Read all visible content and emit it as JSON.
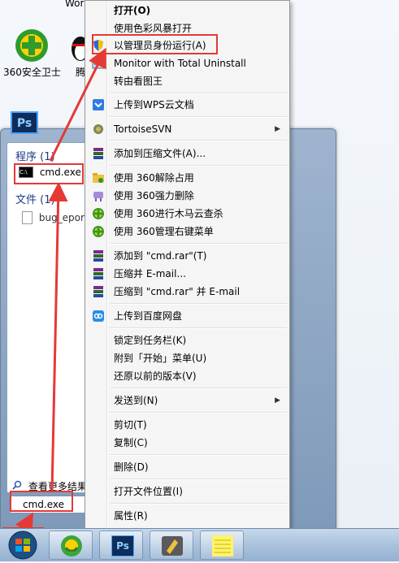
{
  "desktop": {
    "top_clipped_text": "Wor",
    "icons": [
      {
        "label": "360安全卫士"
      },
      {
        "label": "腾"
      }
    ]
  },
  "start_menu": {
    "section_programs": "程序 (1)",
    "program_item": "cmd.exe",
    "section_files": "文件 (1)",
    "file_item": "bug_epor",
    "see_more": "查看更多结果",
    "search_value": "cmd.exe"
  },
  "context_menu": {
    "items": [
      {
        "label": "打开(O)",
        "bold": true
      },
      {
        "label": "使用色彩风暴打开"
      },
      {
        "label": "以管理员身份运行(A)"
      },
      {
        "label": "Monitor with Total Uninstall"
      },
      {
        "label": "转由看图王"
      },
      {
        "label": "上传到WPS云文档"
      },
      {
        "label": "TortoiseSVN"
      },
      {
        "label": "添加到压缩文件(A)..."
      },
      {
        "label": "使用 360解除占用"
      },
      {
        "label": "使用 360强力删除"
      },
      {
        "label": "使用 360进行木马云查杀"
      },
      {
        "label": "使用 360管理右键菜单"
      },
      {
        "label": "添加到 \"cmd.rar\"(T)"
      },
      {
        "label": "压缩并 E-mail..."
      },
      {
        "label": "压缩到 \"cmd.rar\" 并 E-mail"
      },
      {
        "label": "上传到百度网盘"
      },
      {
        "label": "锁定到任务栏(K)"
      },
      {
        "label": "附到「开始」菜单(U)"
      },
      {
        "label": "还原以前的版本(V)"
      },
      {
        "label": "发送到(N)"
      },
      {
        "label": "剪切(T)"
      },
      {
        "label": "复制(C)"
      },
      {
        "label": "删除(D)"
      },
      {
        "label": "打开文件位置(I)"
      },
      {
        "label": "属性(R)"
      }
    ]
  },
  "taskbar": {
    "apps": [
      "start-orb",
      "360-browser",
      "photoshop",
      "tool",
      "notepad"
    ]
  },
  "colors": {
    "annotation": "#e53935",
    "section_head": "#1e3a8a"
  }
}
